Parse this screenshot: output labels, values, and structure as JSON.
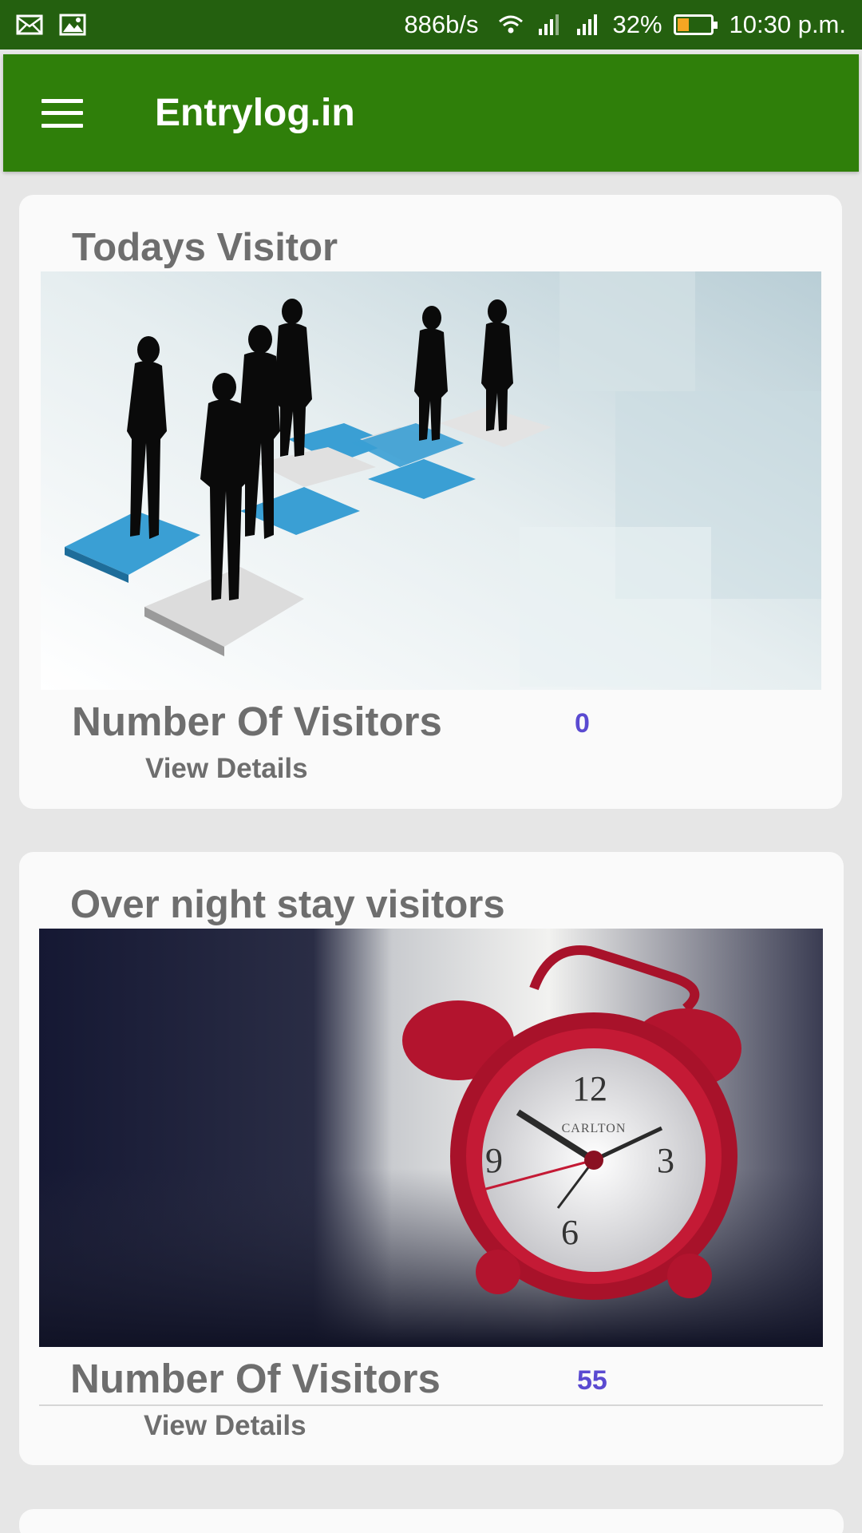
{
  "status_bar": {
    "speed": "886b/s",
    "battery": "32%",
    "time": "10:30 p.m.",
    "icons": [
      "mail-icon",
      "image-icon",
      "wifi-icon",
      "signal-icon",
      "signal-icon",
      "battery-icon"
    ]
  },
  "app_bar": {
    "title": "Entrylog.in",
    "menu_icon": "hamburger-menu-icon",
    "color": "#2f7f0a"
  },
  "cards": [
    {
      "title": "Todays Visitor",
      "image": "people-silhouettes-on-platforms",
      "label": "Number Of Visitors",
      "count": "0",
      "link": "View Details"
    },
    {
      "title": "Over night stay visitors",
      "image": "red-alarm-clock",
      "clock_brand": "CARLTON",
      "label": "Number Of Visitors",
      "count": "55",
      "link": "View Details"
    }
  ],
  "colors": {
    "status_bar": "#24600f",
    "count": "#5a4ad1",
    "text": "#6e6e6e",
    "background": "#e6e6e6"
  }
}
